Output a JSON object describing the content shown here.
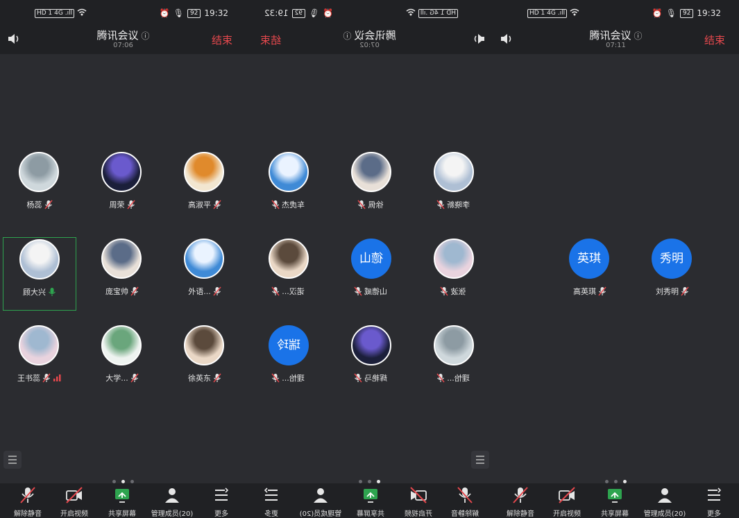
{
  "colors": {
    "background": "#2b2c30",
    "bar": "#202124",
    "end": "#e5484d",
    "active_border": "#2ea44f",
    "text_avatar": "#1a73e8",
    "mic_muted": "#e5484d",
    "mic_on": "#2ea44f"
  },
  "panels": [
    {
      "status": {
        "left": "HD 1 4G .ıll",
        "time": "19:32",
        "battery": "92"
      },
      "header": {
        "title": "腾讯会议",
        "timer": "07:06",
        "end_label": "结束"
      },
      "participants": [
        {
          "name": "杨蕊",
          "avatar": "photo",
          "mic": "muted"
        },
        {
          "name": "周荣",
          "avatar": "photo",
          "mic": "muted"
        },
        {
          "name": "高淑平",
          "avatar": "photo",
          "mic": "muted"
        },
        {
          "name": "顾大兴",
          "avatar": "photo",
          "mic": "on",
          "active": true
        },
        {
          "name": "庞宝帅",
          "avatar": "photo",
          "mic": "muted"
        },
        {
          "name": "外语...",
          "avatar": "photo",
          "mic": "muted"
        },
        {
          "name": "王书蕊",
          "avatar": "photo",
          "mic": "muted",
          "signal": true
        },
        {
          "name": "大学...",
          "avatar": "photo",
          "mic": "muted"
        },
        {
          "name": "徐英东",
          "avatar": "photo",
          "mic": "muted"
        }
      ],
      "page_dots": 3,
      "page_active": 1,
      "toolbar": [
        "解除静音",
        "开启视频",
        "共享屏幕",
        "管理成员(20)",
        "更多"
      ]
    },
    {
      "status": {
        "left": "HD 1 4G .ıll",
        "time": "19:32",
        "battery": "92"
      },
      "header": {
        "title": "腾讯会议",
        "timer": "07:02",
        "end_label": "结束"
      },
      "participants": [
        {
          "name": "李晓新",
          "avatar": "photo",
          "mic": "muted"
        },
        {
          "name": "徐佩",
          "avatar": "photo",
          "mic": "muted"
        },
        {
          "name": "车虎杰",
          "avatar": "photo",
          "mic": "muted"
        },
        {
          "name": "张波",
          "avatar": "photo",
          "mic": "muted"
        },
        {
          "name": "山德威",
          "avatar": "text",
          "avatar_text": "德山",
          "mic": "muted"
        },
        {
          "name": "诺汉...",
          "avatar": "photo",
          "mic": "muted"
        },
        {
          "name": "理怡...",
          "avatar": "photo",
          "mic": "muted"
        },
        {
          "name": "辉艳马",
          "avatar": "photo",
          "mic": "muted"
        },
        {
          "name": "理怡...",
          "avatar": "text",
          "avatar_text": "瑞玲",
          "mic": "muted"
        }
      ],
      "page_dots": 3,
      "page_active": 0,
      "toolbar": [
        "解除静音",
        "开启视频",
        "共享屏幕",
        "管理成员(20)",
        "更多"
      ]
    },
    {
      "status": {
        "left": "HD 1 4G .ıll",
        "time": "19:32",
        "battery": "92"
      },
      "header": {
        "title": "腾讯会议",
        "timer": "07:11",
        "end_label": "结束"
      },
      "participants": [
        {
          "name": "高英琪",
          "avatar": "text",
          "avatar_text": "英琪",
          "mic": "muted"
        },
        {
          "name": "刘秀明",
          "avatar": "text",
          "avatar_text": "秀明",
          "mic": "muted"
        }
      ],
      "page_dots": 3,
      "page_active": 2,
      "toolbar": [
        "解除静音",
        "开启视频",
        "共享屏幕",
        "管理成员(20)",
        "更多"
      ]
    }
  ]
}
